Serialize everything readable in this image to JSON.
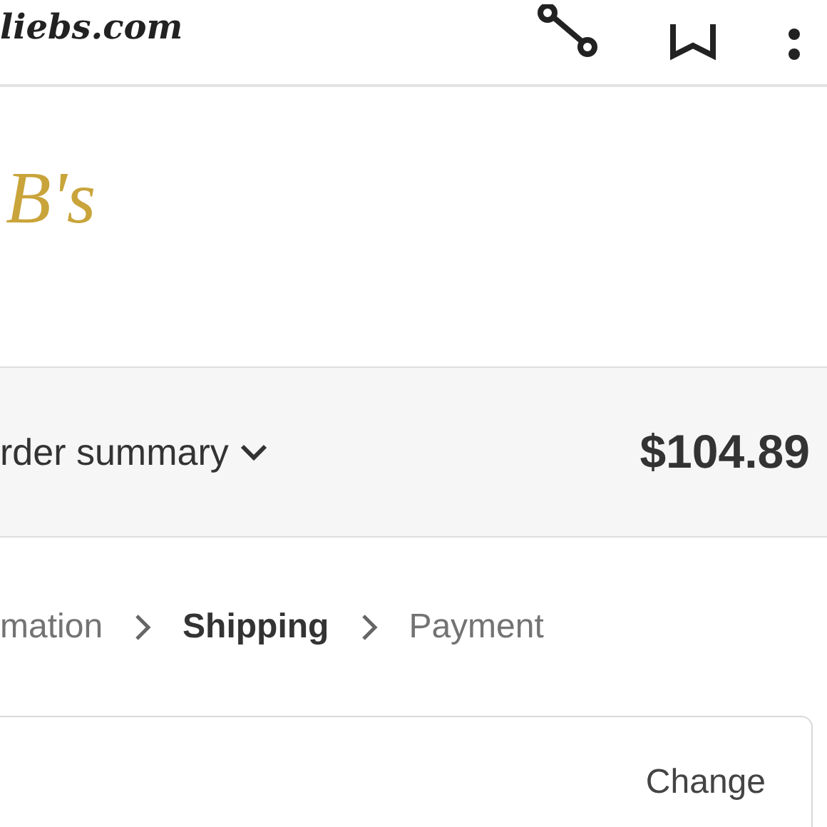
{
  "browser_bar": {
    "site_name": "liebs.com"
  },
  "logo": {
    "text": "B's"
  },
  "order_summary": {
    "label": "rder summary",
    "expanded": false,
    "total": "$104.89"
  },
  "breadcrumbs": [
    {
      "label": "mation",
      "selected": false
    },
    {
      "label": "Shipping",
      "selected": true
    },
    {
      "label": "Payment",
      "selected": false
    }
  ],
  "contact_card": {
    "action": "Change"
  }
}
